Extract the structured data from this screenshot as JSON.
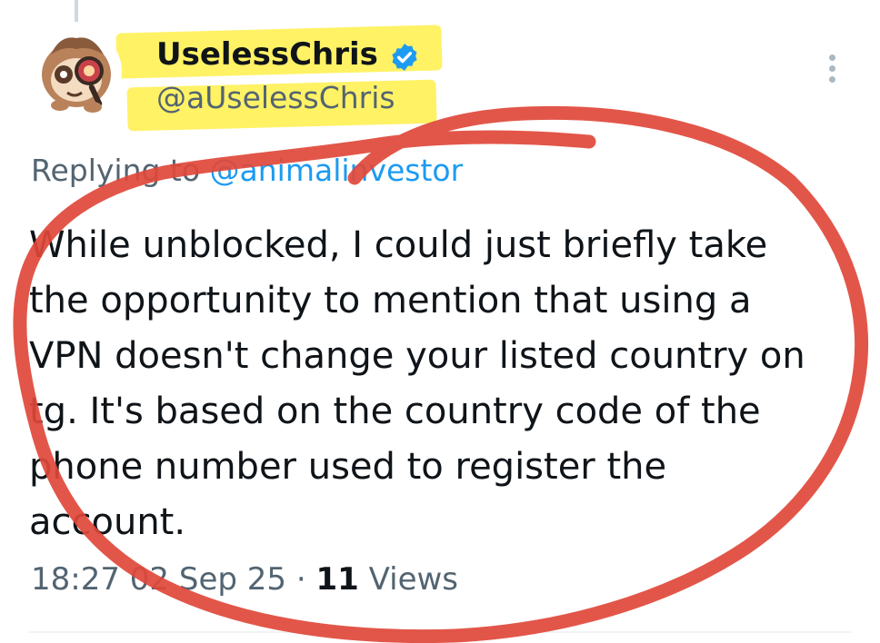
{
  "tweet": {
    "display_name": "UselessChris",
    "handle": "@aUselessChris",
    "verified": true,
    "replying_prefix": "Replying to ",
    "replying_to": "@animalinvestor",
    "text": "While unblocked, I could just briefly take the opportunity to mention that using a VPN doesn't change your listed country on tg. It's based on the country code of the phone number used to register the account.",
    "time": "18:27",
    "date": "02 Sep 25",
    "separator": " · ",
    "views_count": "11",
    "views_label": " Views"
  },
  "icons": {
    "avatar": "sloth-with-magnifying-glass-avatar",
    "verified": "verified-badge-icon",
    "more": "more-options-icon"
  },
  "colors": {
    "highlight": "#fff04a",
    "annotation": "#e0483a",
    "link": "#1d9bf0",
    "secondary_text": "#536471",
    "verified": "#1d9bf0"
  }
}
